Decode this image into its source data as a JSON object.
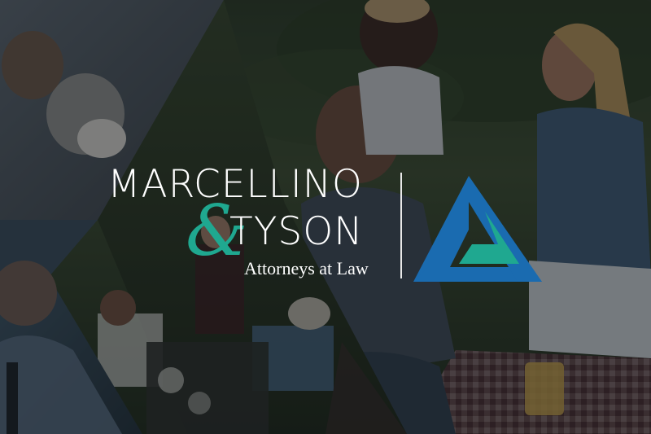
{
  "brand": {
    "name_line1": "MARCELLINO",
    "ampersand": "&",
    "name_line2": "TYSON",
    "tagline": "Attorneys at Law"
  },
  "colors": {
    "teal": "#1fa890",
    "blue": "#1a6bb0",
    "overlay": "#0e1216",
    "text": "#ffffff"
  },
  "icons": {
    "logo_mark": "triangle-logo-icon"
  }
}
